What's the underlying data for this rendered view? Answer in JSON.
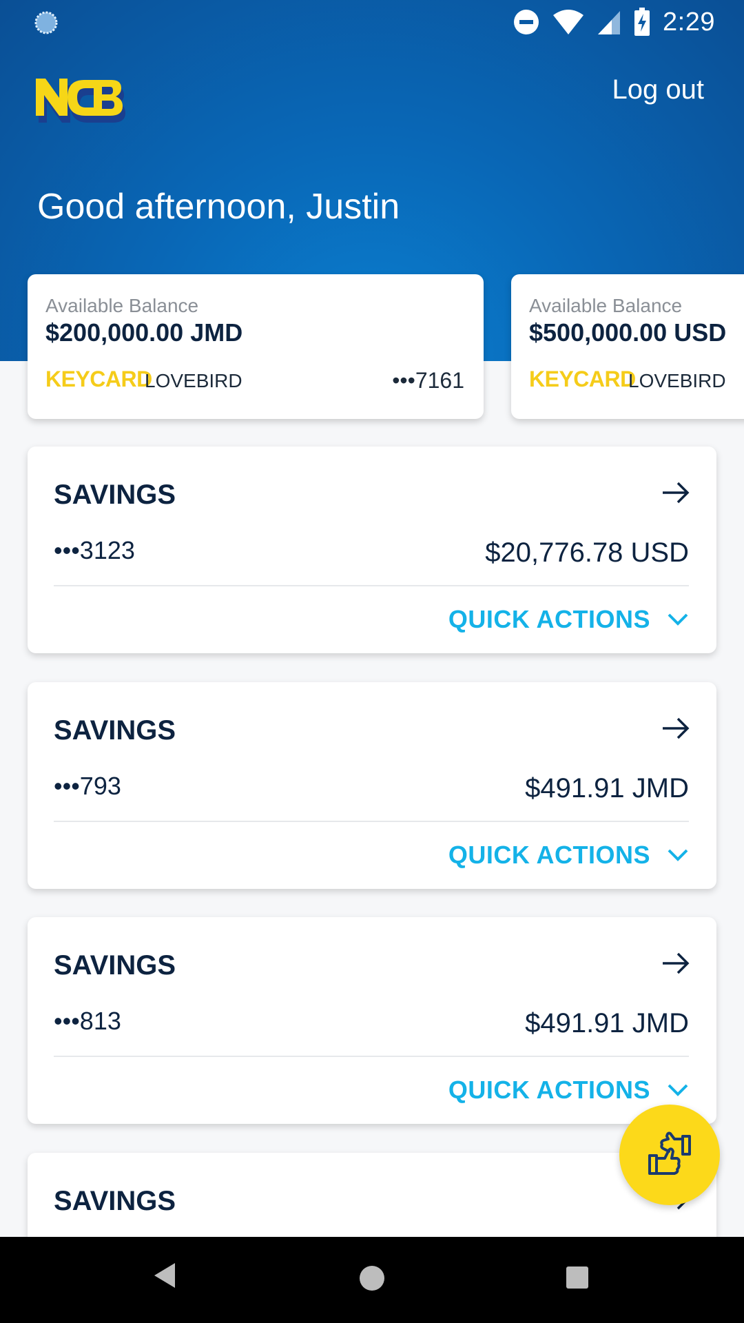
{
  "status_bar": {
    "time": "2:29",
    "icons": [
      "sync-icon",
      "do-not-disturb-icon",
      "wifi-icon",
      "cell-signal-icon",
      "battery-charging-icon"
    ]
  },
  "header": {
    "logo_text": "NCB",
    "logout_label": "Log out",
    "greeting": "Good afternoon, Justin"
  },
  "accounts": [
    {
      "label": "Available Balance",
      "balance": "$200,000.00 JMD",
      "brand": "KEYCARD",
      "nickname": "LOVEBIRD",
      "masked_number": "•••7161"
    },
    {
      "label": "Available Balance",
      "balance": "$500,000.00 USD",
      "brand": "KEYCARD",
      "nickname": "LOVEBIRD",
      "masked_number": ""
    }
  ],
  "savings": [
    {
      "title": "SAVINGS",
      "masked_number": "•••3123",
      "amount": "$20,776.78 USD",
      "quick_actions": "QUICK ACTIONS"
    },
    {
      "title": "SAVINGS",
      "masked_number": "•••793",
      "amount": "$491.91 JMD",
      "quick_actions": "QUICK ACTIONS"
    },
    {
      "title": "SAVINGS",
      "masked_number": "•••813",
      "amount": "$491.91 JMD",
      "quick_actions": "QUICK ACTIONS"
    },
    {
      "title": "SAVINGS"
    }
  ],
  "colors": {
    "brand_blue": "#0967b6",
    "brand_yellow": "#fcd91a",
    "link_cyan": "#14b2e8",
    "navy_text": "#0d2340"
  },
  "fab": {
    "icon": "transfer-hands-icon"
  },
  "nav": {
    "icons": [
      "back-icon",
      "home-icon",
      "recents-icon"
    ]
  }
}
